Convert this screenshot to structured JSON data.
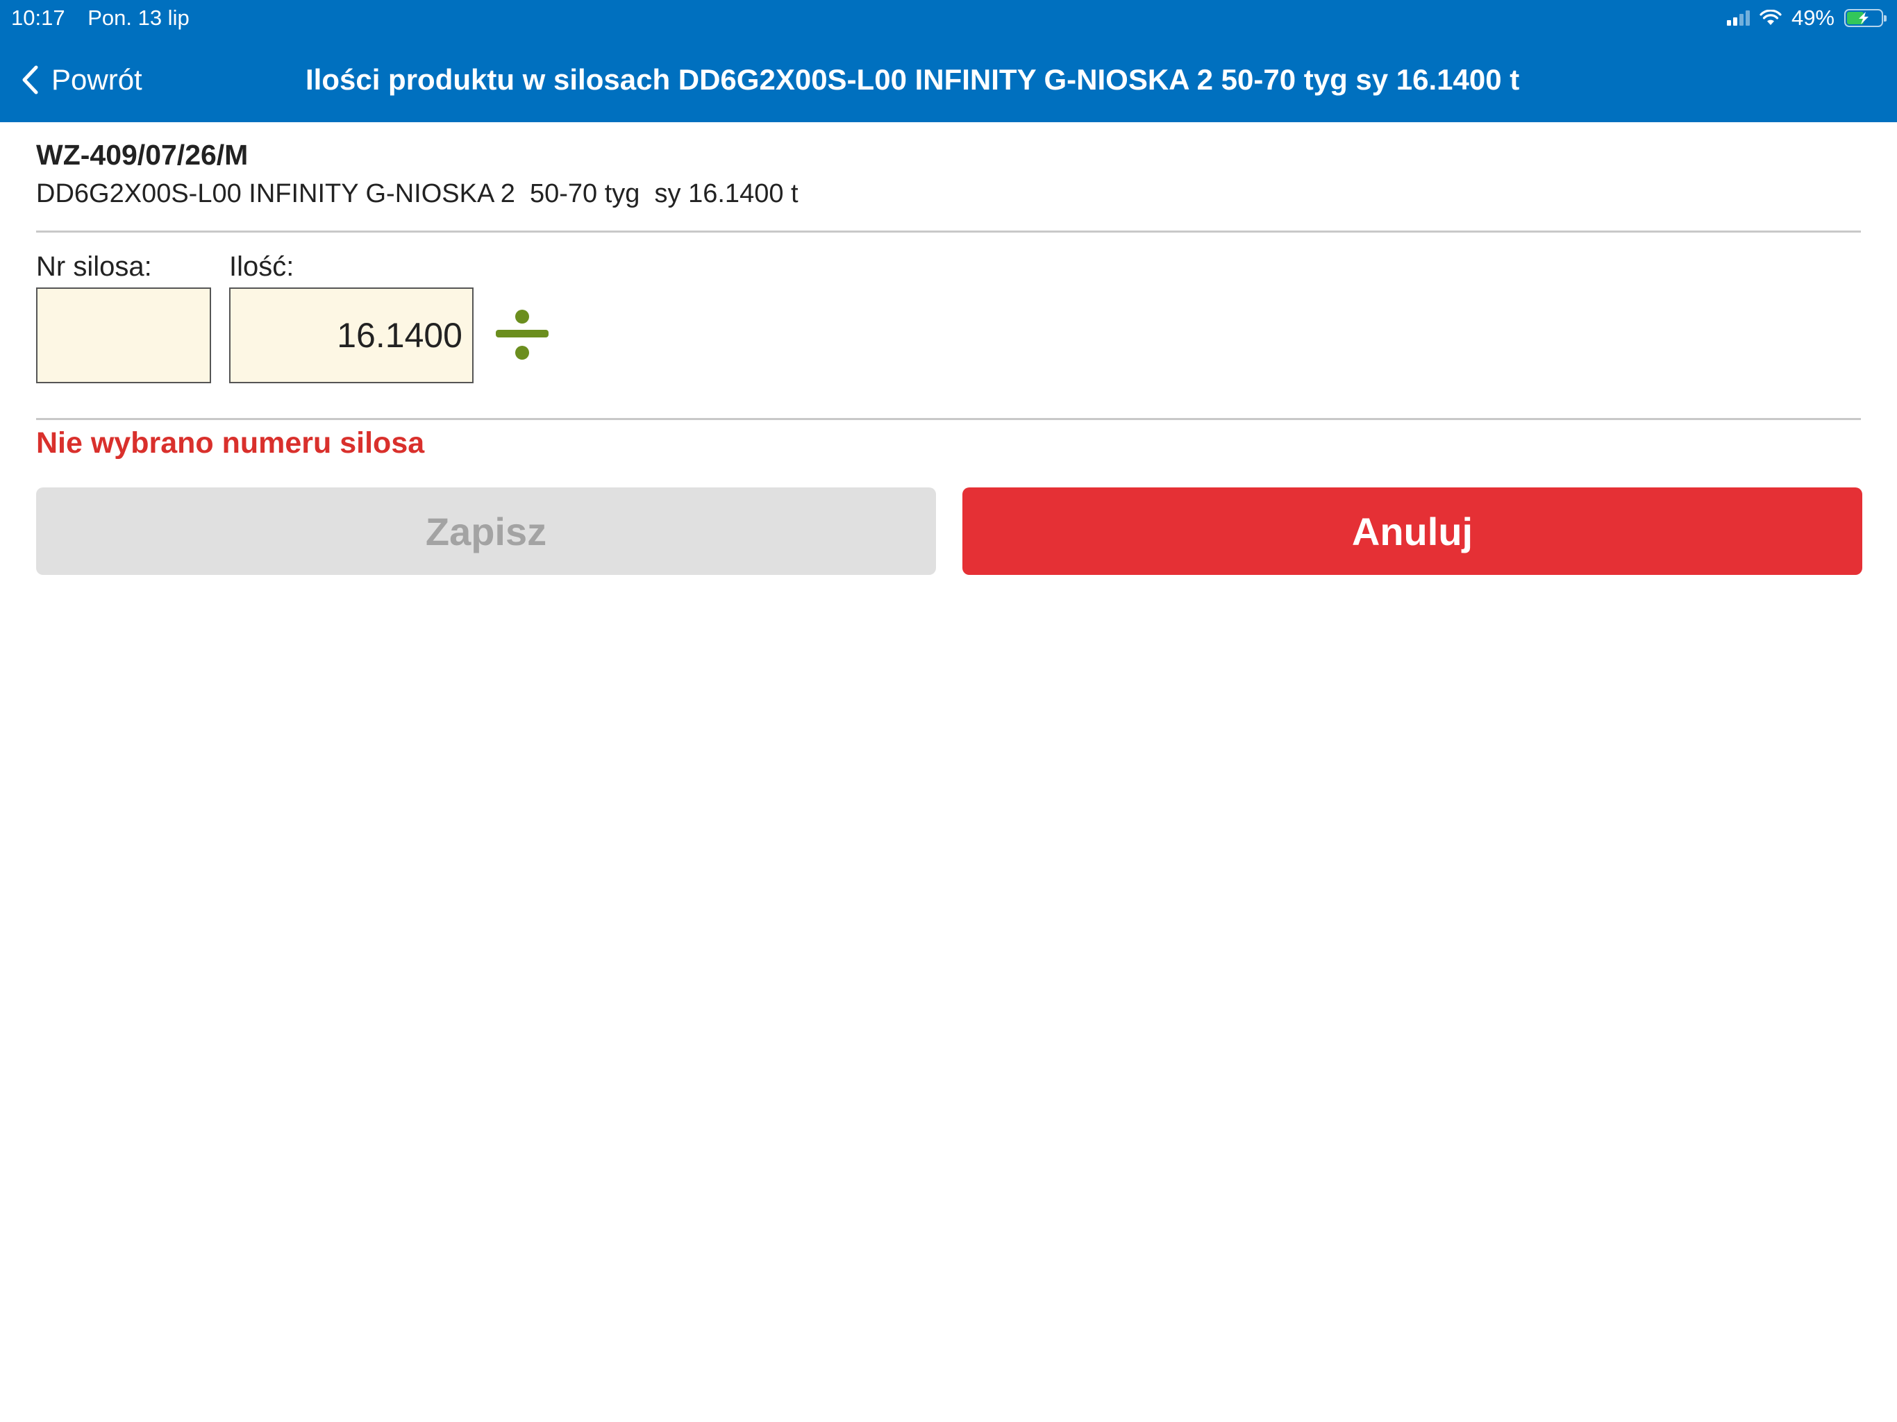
{
  "status_bar": {
    "time": "10:17",
    "date": "Pon. 13 lip",
    "battery_percent": "49%",
    "battery_level": 0.49
  },
  "nav": {
    "back_label": "Powrót",
    "title": "Ilości produktu w silosach DD6G2X00S-L00 INFINITY G-NIOSKA 2  50-70 tyg  sy 16.1400 t"
  },
  "document": {
    "number": "WZ-409/07/26/M",
    "product": "DD6G2X00S-L00 INFINITY G-NIOSKA 2  50-70 tyg  sy 16.1400 t"
  },
  "form": {
    "silo_label": "Nr silosa:",
    "silo_value": "",
    "quantity_label": "Ilość:",
    "quantity_value": "16.1400"
  },
  "error_message": "Nie wybrano numeru silosa",
  "buttons": {
    "save_label": "Zapisz",
    "cancel_label": "Anuluj"
  },
  "colors": {
    "header": "#0070bf",
    "error": "#d9302c",
    "cancel": "#e53035",
    "divide_icon": "#6b8e1e"
  },
  "icons": {
    "back": "chevron-left-icon",
    "divide": "divide-icon"
  }
}
